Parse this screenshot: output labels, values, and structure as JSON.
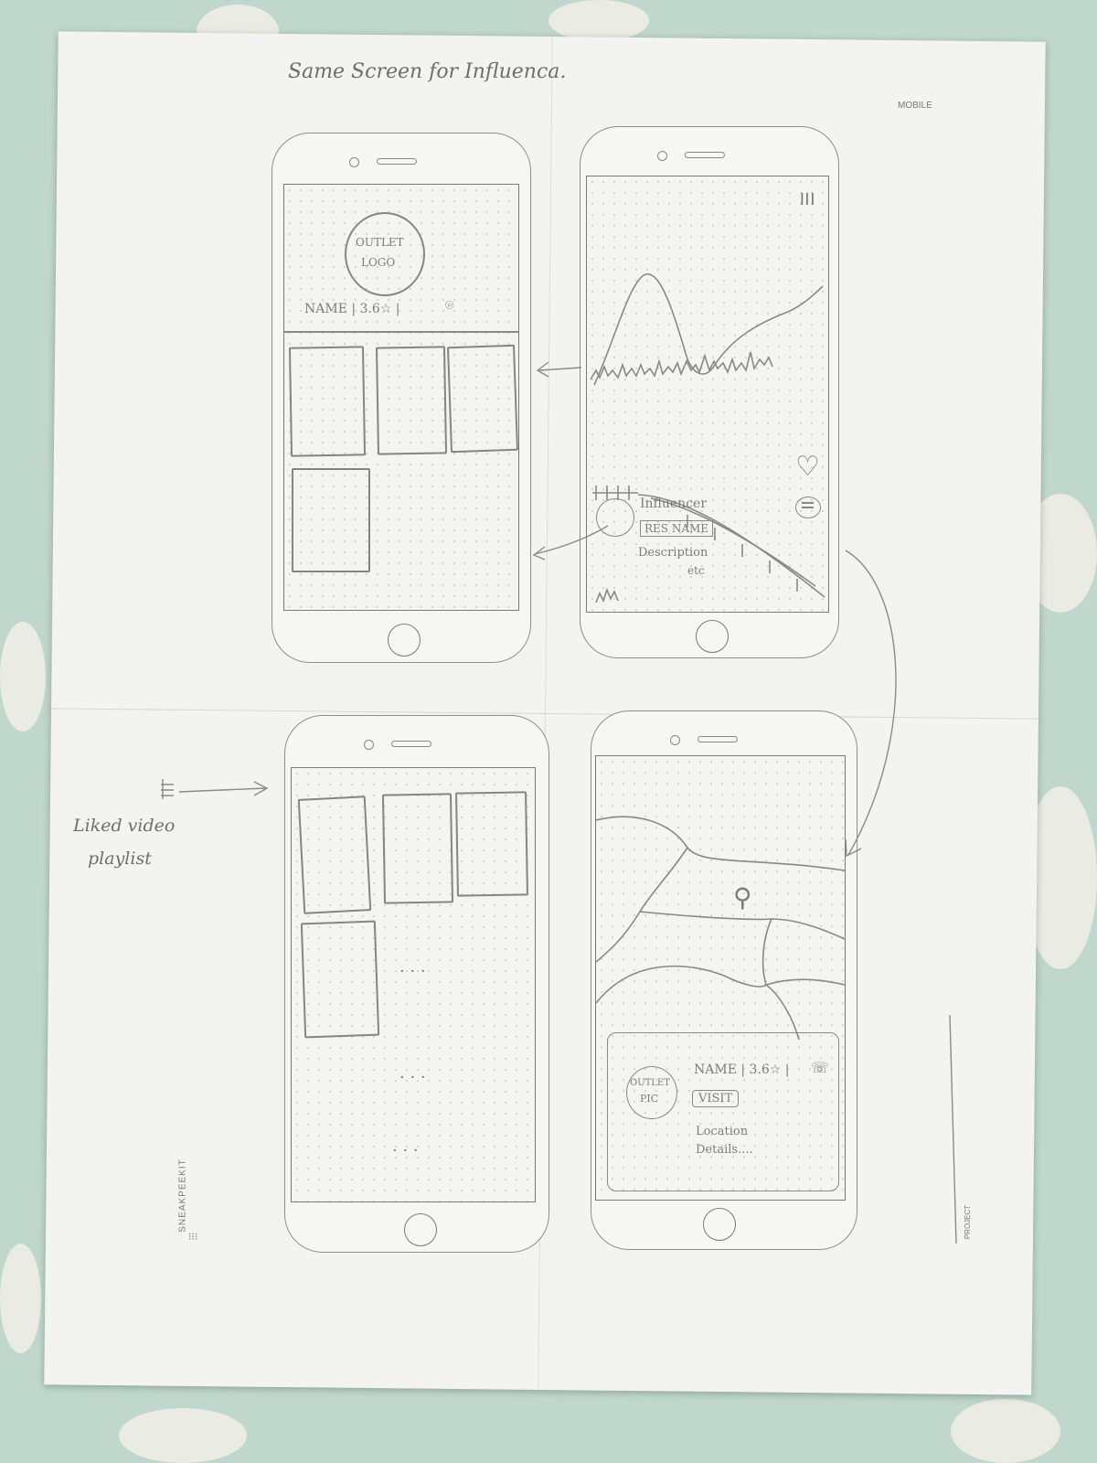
{
  "sheet": {
    "note_top": "Same Screen for Influenca.",
    "mobile_label": "MOBILE",
    "brand_label": "SNEAKPEEKIT",
    "project_label": "PROJECT",
    "liked_note_line1": "Liked video",
    "liked_note_line2": "playlist"
  },
  "outlet_screen": {
    "logo_line1": "OUTLET",
    "logo_line2": "LOGO",
    "name_rating": "NAME | 3.6☆ |"
  },
  "video_screen": {
    "influencer_label": "Influencer",
    "res_name": "RES NAME",
    "description_line1": "Description",
    "description_line2": "etc"
  },
  "map_screen": {
    "pic_line1": "OUTLET",
    "pic_line2": "PIC",
    "name_rating": "NAME | 3.6☆ |",
    "visit_label": "VISIT",
    "location_line1": "Location",
    "location_line2": "Details...."
  }
}
